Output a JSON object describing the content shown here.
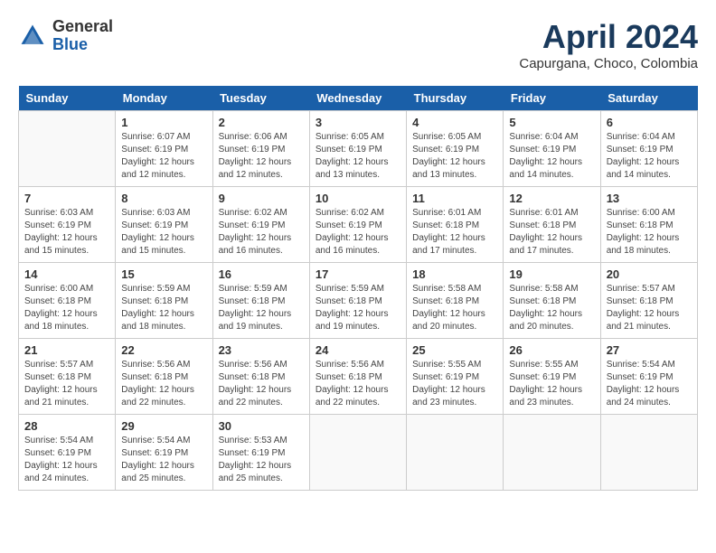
{
  "header": {
    "logo_general": "General",
    "logo_blue": "Blue",
    "month": "April 2024",
    "location": "Capurgana, Choco, Colombia"
  },
  "days_of_week": [
    "Sunday",
    "Monday",
    "Tuesday",
    "Wednesday",
    "Thursday",
    "Friday",
    "Saturday"
  ],
  "weeks": [
    [
      {
        "day": "",
        "empty": true
      },
      {
        "day": "1",
        "sunrise": "6:07 AM",
        "sunset": "6:19 PM",
        "daylight": "12 hours and 12 minutes."
      },
      {
        "day": "2",
        "sunrise": "6:06 AM",
        "sunset": "6:19 PM",
        "daylight": "12 hours and 12 minutes."
      },
      {
        "day": "3",
        "sunrise": "6:05 AM",
        "sunset": "6:19 PM",
        "daylight": "12 hours and 13 minutes."
      },
      {
        "day": "4",
        "sunrise": "6:05 AM",
        "sunset": "6:19 PM",
        "daylight": "12 hours and 13 minutes."
      },
      {
        "day": "5",
        "sunrise": "6:04 AM",
        "sunset": "6:19 PM",
        "daylight": "12 hours and 14 minutes."
      },
      {
        "day": "6",
        "sunrise": "6:04 AM",
        "sunset": "6:19 PM",
        "daylight": "12 hours and 14 minutes."
      }
    ],
    [
      {
        "day": "7",
        "sunrise": "6:03 AM",
        "sunset": "6:19 PM",
        "daylight": "12 hours and 15 minutes."
      },
      {
        "day": "8",
        "sunrise": "6:03 AM",
        "sunset": "6:19 PM",
        "daylight": "12 hours and 15 minutes."
      },
      {
        "day": "9",
        "sunrise": "6:02 AM",
        "sunset": "6:19 PM",
        "daylight": "12 hours and 16 minutes."
      },
      {
        "day": "10",
        "sunrise": "6:02 AM",
        "sunset": "6:19 PM",
        "daylight": "12 hours and 16 minutes."
      },
      {
        "day": "11",
        "sunrise": "6:01 AM",
        "sunset": "6:18 PM",
        "daylight": "12 hours and 17 minutes."
      },
      {
        "day": "12",
        "sunrise": "6:01 AM",
        "sunset": "6:18 PM",
        "daylight": "12 hours and 17 minutes."
      },
      {
        "day": "13",
        "sunrise": "6:00 AM",
        "sunset": "6:18 PM",
        "daylight": "12 hours and 18 minutes."
      }
    ],
    [
      {
        "day": "14",
        "sunrise": "6:00 AM",
        "sunset": "6:18 PM",
        "daylight": "12 hours and 18 minutes."
      },
      {
        "day": "15",
        "sunrise": "5:59 AM",
        "sunset": "6:18 PM",
        "daylight": "12 hours and 18 minutes."
      },
      {
        "day": "16",
        "sunrise": "5:59 AM",
        "sunset": "6:18 PM",
        "daylight": "12 hours and 19 minutes."
      },
      {
        "day": "17",
        "sunrise": "5:59 AM",
        "sunset": "6:18 PM",
        "daylight": "12 hours and 19 minutes."
      },
      {
        "day": "18",
        "sunrise": "5:58 AM",
        "sunset": "6:18 PM",
        "daylight": "12 hours and 20 minutes."
      },
      {
        "day": "19",
        "sunrise": "5:58 AM",
        "sunset": "6:18 PM",
        "daylight": "12 hours and 20 minutes."
      },
      {
        "day": "20",
        "sunrise": "5:57 AM",
        "sunset": "6:18 PM",
        "daylight": "12 hours and 21 minutes."
      }
    ],
    [
      {
        "day": "21",
        "sunrise": "5:57 AM",
        "sunset": "6:18 PM",
        "daylight": "12 hours and 21 minutes."
      },
      {
        "day": "22",
        "sunrise": "5:56 AM",
        "sunset": "6:18 PM",
        "daylight": "12 hours and 22 minutes."
      },
      {
        "day": "23",
        "sunrise": "5:56 AM",
        "sunset": "6:18 PM",
        "daylight": "12 hours and 22 minutes."
      },
      {
        "day": "24",
        "sunrise": "5:56 AM",
        "sunset": "6:18 PM",
        "daylight": "12 hours and 22 minutes."
      },
      {
        "day": "25",
        "sunrise": "5:55 AM",
        "sunset": "6:19 PM",
        "daylight": "12 hours and 23 minutes."
      },
      {
        "day": "26",
        "sunrise": "5:55 AM",
        "sunset": "6:19 PM",
        "daylight": "12 hours and 23 minutes."
      },
      {
        "day": "27",
        "sunrise": "5:54 AM",
        "sunset": "6:19 PM",
        "daylight": "12 hours and 24 minutes."
      }
    ],
    [
      {
        "day": "28",
        "sunrise": "5:54 AM",
        "sunset": "6:19 PM",
        "daylight": "12 hours and 24 minutes."
      },
      {
        "day": "29",
        "sunrise": "5:54 AM",
        "sunset": "6:19 PM",
        "daylight": "12 hours and 25 minutes."
      },
      {
        "day": "30",
        "sunrise": "5:53 AM",
        "sunset": "6:19 PM",
        "daylight": "12 hours and 25 minutes."
      },
      {
        "day": "",
        "empty": true
      },
      {
        "day": "",
        "empty": true
      },
      {
        "day": "",
        "empty": true
      },
      {
        "day": "",
        "empty": true
      }
    ]
  ]
}
